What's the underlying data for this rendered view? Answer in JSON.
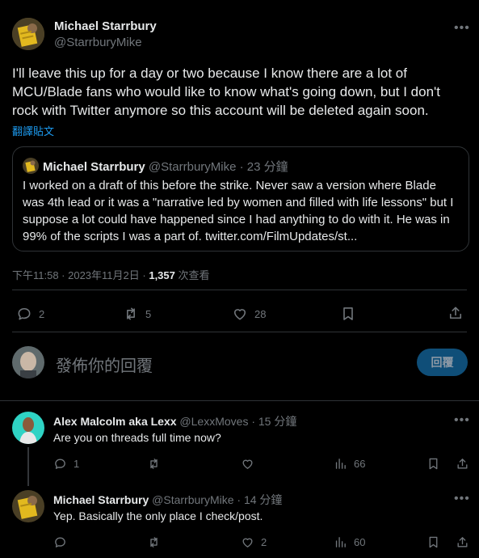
{
  "main_tweet": {
    "author_name": "Michael Starrbury",
    "handle": "@StarrburyMike",
    "text": "I'll leave this up for a day or two because I know there are a lot of MCU/Blade fans who would like to know what's going down, but I don't rock with Twitter anymore so this account will be deleted again soon.",
    "translate_label": "翻譯貼文",
    "quote": {
      "author_name": "Michael Starrbury",
      "handle_time": "@StarrburyMike · 23 分鐘",
      "text": "I worked on a draft of this before the strike. Never saw a version where Blade was 4th lead or it was a \"narrative led by women and filled with life lessons\" but I suppose a lot could have happened since I had anything to do with it. He was in 99% of the scripts I was a part of. twitter.com/FilmUpdates/st..."
    },
    "timestamp": "下午11:58 · 2023年11月2日 ·",
    "views_count": "1,357",
    "views_label": "次查看",
    "actions": {
      "replies": "2",
      "retweets": "5",
      "likes": "28"
    }
  },
  "compose": {
    "placeholder": "發佈你的回覆",
    "reply_button": "回覆"
  },
  "replies": [
    {
      "author_name": "Alex Malcolm aka Lexx",
      "handle_time": "@LexxMoves · 15 分鐘",
      "text": "Are you on threads full time now?",
      "replies": "1",
      "retweets": "",
      "likes": "",
      "views": "66"
    },
    {
      "author_name": "Michael Starrbury",
      "handle_time": "@StarrburyMike · 14 分鐘",
      "text": "Yep. Basically the only place I check/post.",
      "replies": "",
      "retweets": "",
      "likes": "2",
      "views": "60"
    }
  ],
  "colors": {
    "background": "#000000",
    "text": "#e7e9ea",
    "muted": "#71767b",
    "link": "#1d9bf0",
    "border": "#2f3336",
    "reply_button_bg": "#0f4e78"
  }
}
